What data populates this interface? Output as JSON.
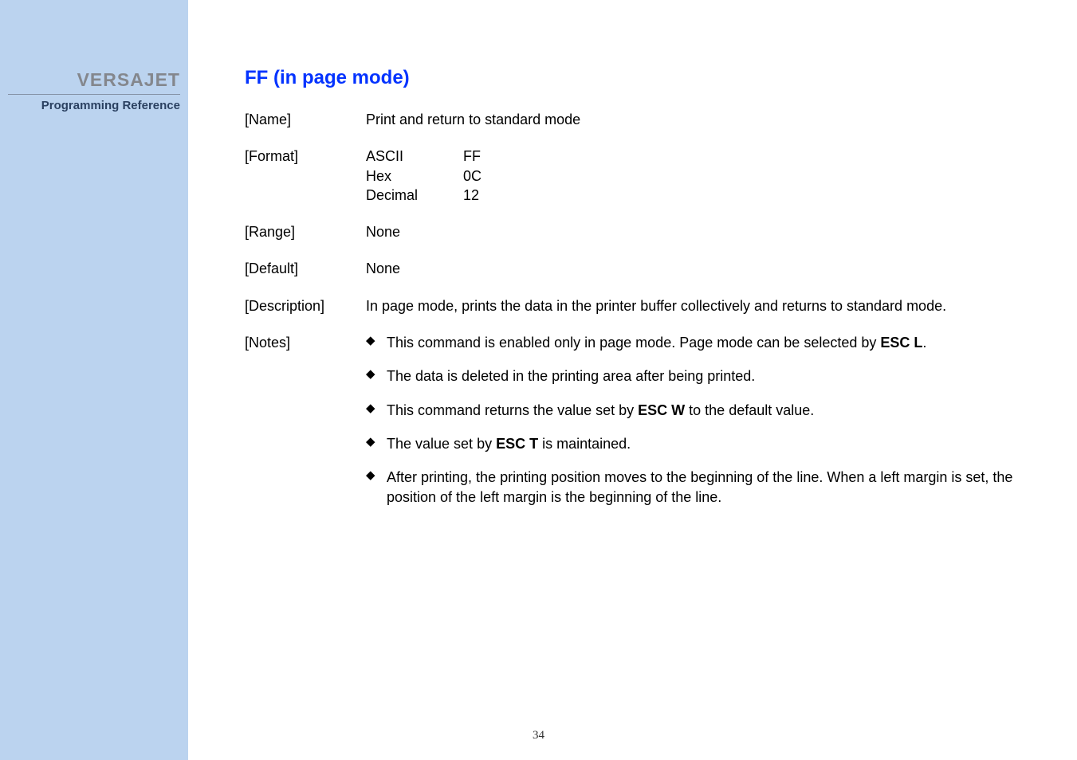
{
  "sidebar": {
    "brand": "VERSAJET",
    "reference": "Programming Reference"
  },
  "title": "FF (in page mode)",
  "name": {
    "label": "[Name]",
    "value": "Print and return to standard mode"
  },
  "format": {
    "label": "[Format]",
    "rows": [
      {
        "key": "ASCII",
        "val": "FF"
      },
      {
        "key": "Hex",
        "val": "0C"
      },
      {
        "key": "Decimal",
        "val": "12"
      }
    ]
  },
  "range": {
    "label": "[Range]",
    "value": "None"
  },
  "default": {
    "label": "[Default]",
    "value": "None"
  },
  "description": {
    "label": "[Description]",
    "value": "In page mode, prints the data in the printer buffer collectively and returns to standard mode."
  },
  "notes": {
    "label": "[Notes]",
    "items": [
      {
        "pre": "This command is enabled only in page mode. Page mode can be selected by ",
        "bold": "ESC L",
        "post": "."
      },
      {
        "pre": "The data is deleted in the printing area after being printed.",
        "bold": "",
        "post": ""
      },
      {
        "pre": "This command returns the value set by ",
        "bold": "ESC W",
        "post": " to the default value."
      },
      {
        "pre": "The value set by ",
        "bold": "ESC T",
        "post": " is maintained."
      },
      {
        "pre": "After printing, the printing position moves to the beginning of the line. When a left margin is set, the position of the left margin is the beginning of the line.",
        "bold": "",
        "post": ""
      }
    ]
  },
  "page_number": "34"
}
